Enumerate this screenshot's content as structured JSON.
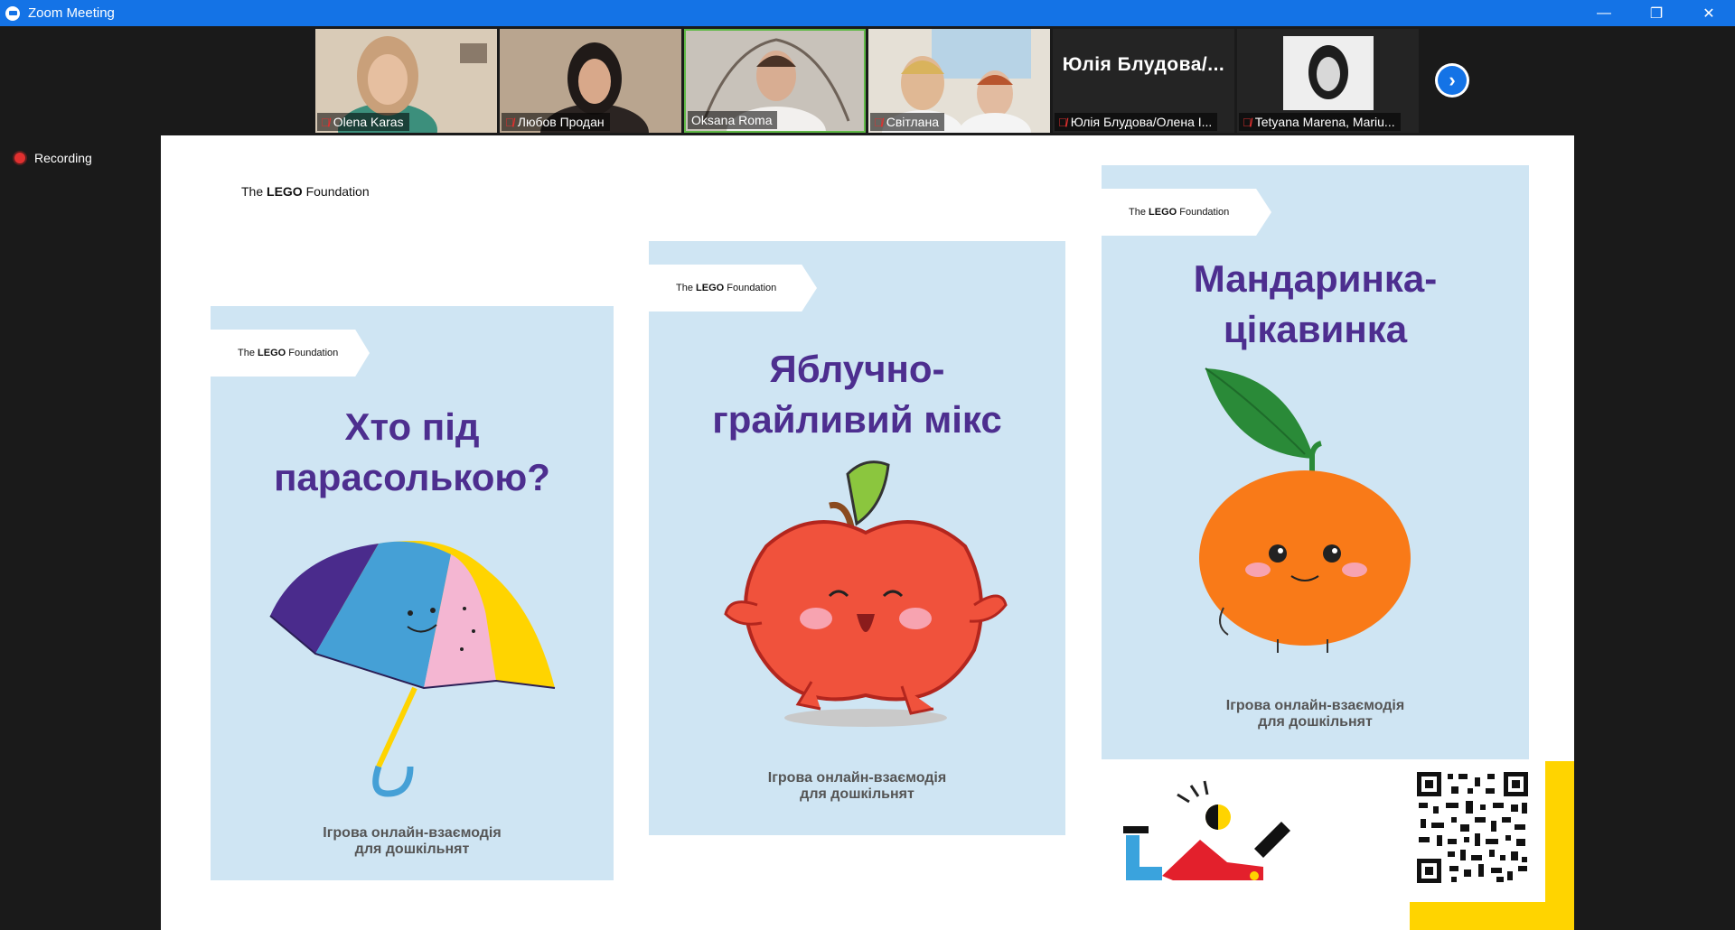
{
  "window": {
    "title": "Zoom Meeting",
    "controls": {
      "minimize": "—",
      "restore": "❐",
      "close": "✕"
    }
  },
  "participants": [
    {
      "name": "Olena Karas",
      "muted": true
    },
    {
      "name": "Любов Продан",
      "muted": true
    },
    {
      "name": "Oksana Roma",
      "muted": false,
      "active_speaker": true
    },
    {
      "name": "Світлана",
      "muted": true
    },
    {
      "name": "Юлія Блудова/Олена І...",
      "display_name": "Юлія  Блудова/...",
      "muted": true,
      "video_off": true
    },
    {
      "name": "Tetyana Marena, Mariu...",
      "muted": true
    }
  ],
  "next_page_icon": "chevron-right",
  "recording": {
    "label": "Recording"
  },
  "slide": {
    "logo": {
      "prefix": "The ",
      "brand": "LEGO",
      "suffix": " Foundation"
    },
    "cards": [
      {
        "title_line1": "Хто під",
        "title_line2": "парасолькою?",
        "subtitle_line1": "Ігрова онлайн-взаємодія",
        "subtitle_line2": "для дошкільнят",
        "illustration": "umbrella"
      },
      {
        "title_line1": "Яблучно-",
        "title_line2": "грайливий мікс",
        "subtitle_line1": "Ігрова онлайн-взаємодія",
        "subtitle_line2": "для дошкільнят",
        "illustration": "apple"
      },
      {
        "title_line1": "Мандаринка-",
        "title_line2": "цікавинка",
        "subtitle_line1": "Ігрова онлайн-взаємодія",
        "subtitle_line2": "для дошкільнят",
        "illustration": "tangerine"
      }
    ],
    "colors": {
      "card_bg": "#cfe5f3",
      "title": "#4d2e8f",
      "accent_yellow": "#ffd400"
    }
  }
}
